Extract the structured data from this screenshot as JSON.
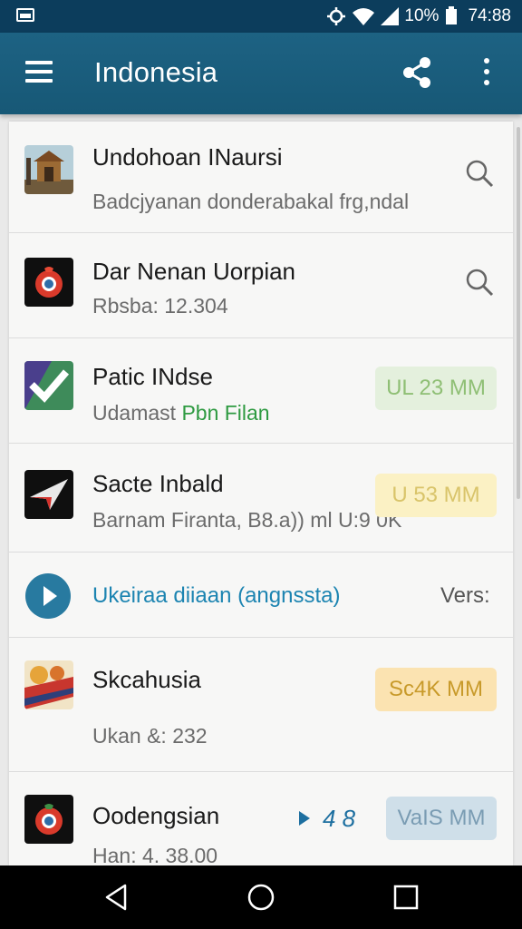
{
  "status_bar": {
    "battery": "10%",
    "time": "74:88"
  },
  "app_bar": {
    "title": "Indonesia"
  },
  "list": [
    {
      "title": "Undohoan INaursi",
      "subtitle": "Badcjyanan donderabakal frg,ndal",
      "action": "search"
    },
    {
      "title": "Dar Nenan Uorpian",
      "subtitle": "Rbsba: 12.304",
      "action": "search"
    },
    {
      "title": "Patic INdse",
      "subtitle_a": "Udamast ",
      "subtitle_b": "Pbn Filan",
      "badge": "UL 23 MM"
    },
    {
      "title": "Sacte Inbald",
      "subtitle": "Barnam Firanta, B8.a)) ml U:9 0K",
      "badge": "U 53 MM"
    },
    {
      "link": "Ukeiraa diiaan (angnssta)",
      "trailing": "Vers:"
    },
    {
      "title": "Skcahusia",
      "subtitle": "Ukan &: 232",
      "badge": "Sc4K MM"
    },
    {
      "title": "Oodengsian",
      "subtitle": "Han: 4. 38.00",
      "inline": "4 8",
      "badge": "VaIS MM"
    }
  ],
  "colors": {
    "status_bar": "#0c3d5c",
    "app_bar": "#1d6283",
    "accent_link": "#1c84b1",
    "nav_bar": "#000000"
  }
}
